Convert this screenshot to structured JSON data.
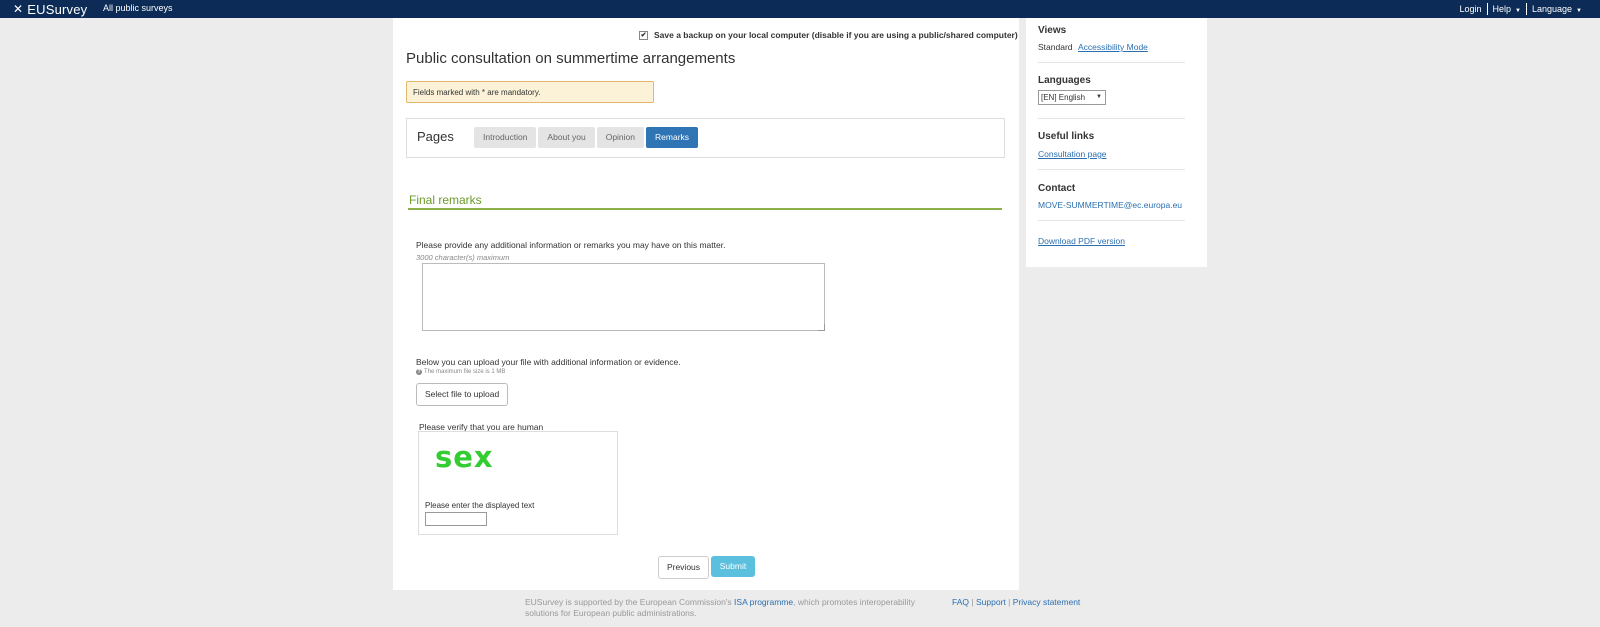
{
  "topbar": {
    "logo": "EUSurvey",
    "all_surveys": "All public surveys",
    "login": "Login",
    "help": "Help",
    "language": "Language"
  },
  "main": {
    "backup_label": "Save a backup on your local computer (disable if you are using a public/shared computer)",
    "title": "Public consultation on summertime arrangements",
    "mandatory_note": "Fields marked with * are mandatory.",
    "pages_label": "Pages",
    "tabs": [
      {
        "label": "Introduction",
        "active": false
      },
      {
        "label": "About you",
        "active": false
      },
      {
        "label": "Opinion",
        "active": false
      },
      {
        "label": "Remarks",
        "active": true
      }
    ],
    "section_title": "Final remarks",
    "question_remarks": "Please provide any additional information or remarks you may have on this matter.",
    "char_limit": "3000 character(s) maximum",
    "remarks_value": "",
    "question_upload": "Below you can upload your file with additional information or evidence.",
    "file_size_hint": "The maximum file size is 1 MB",
    "upload_button": "Select file to upload",
    "verify_label": "Please verify that you are human",
    "captcha_text": "sex",
    "captcha_prompt": "Please enter the displayed text",
    "captcha_value": "",
    "previous_button": "Previous",
    "submit_button": "Submit"
  },
  "sidebar": {
    "views_heading": "Views",
    "views_standard": "Standard",
    "views_accessibility": "Accessibility Mode",
    "languages_heading": "Languages",
    "language_selected": "[EN] English",
    "useful_links_heading": "Useful links",
    "consultation_link": "Consultation page",
    "contact_heading": "Contact",
    "contact_email": "MOVE-SUMMERTIME@ec.europa.eu",
    "download_pdf": "Download PDF version"
  },
  "footer": {
    "text_before": "EUSurvey is supported by the European Commission's",
    "isa_link": "ISA programme",
    "text_after": ", which promotes interoperability solutions for European public administrations.",
    "faq": "FAQ",
    "support": "Support",
    "privacy": "Privacy statement"
  },
  "colors": {
    "topbar": "#0c2b56",
    "active_tab": "#2f74b5",
    "section_title": "#6a9a2a",
    "submit": "#5bbfde",
    "captcha": "#33cc33"
  }
}
